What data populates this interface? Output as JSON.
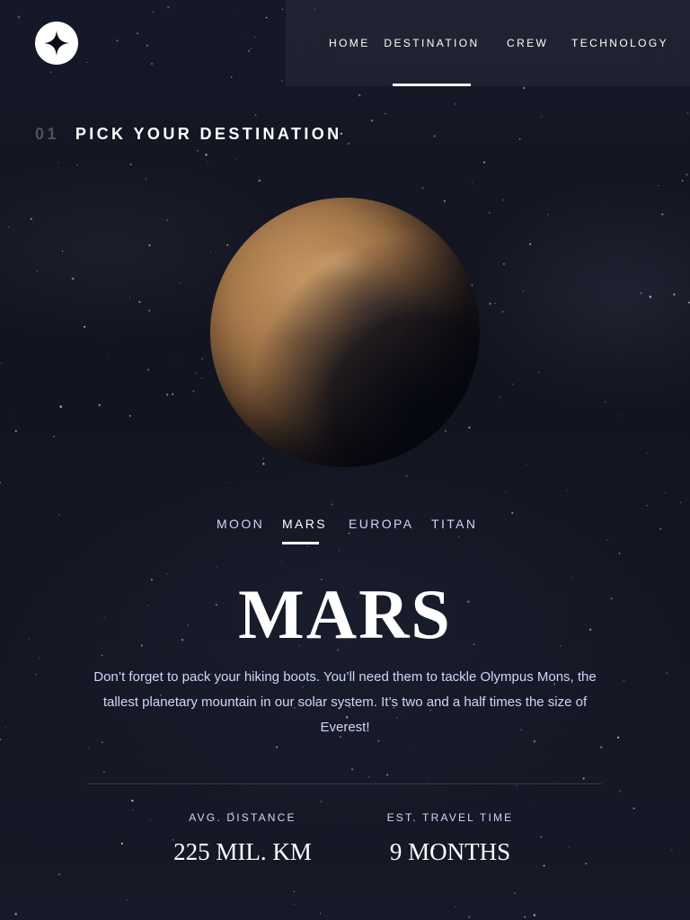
{
  "header": {
    "logo_icon": "star-logo-icon",
    "nav": [
      {
        "key": "home",
        "label": "HOME",
        "active": false
      },
      {
        "key": "destination",
        "label": "DESTINATION",
        "active": true
      },
      {
        "key": "crew",
        "label": "CREW",
        "active": false
      },
      {
        "key": "technology",
        "label": "TECHNOLOGY",
        "active": false
      }
    ]
  },
  "section": {
    "number": "01",
    "title": "PICK YOUR DESTINATION"
  },
  "tabs": [
    {
      "label": "MOON",
      "active": false
    },
    {
      "label": "MARS",
      "active": true
    },
    {
      "label": "EUROPA",
      "active": false
    },
    {
      "label": "TITAN",
      "active": false
    }
  ],
  "destination": {
    "image": "mars-planet-image",
    "name": "MARS",
    "description": "Don’t forget to pack your hiking boots. You’ll need them to tackle Olympus Mons, the tallest planetary mountain in our solar system. It’s two and a half times the size of Everest!",
    "stats": {
      "distance_label": "AVG. DISTANCE",
      "distance_value": "225 MIL. KM",
      "travel_label": "EST. TRAVEL TIME",
      "travel_value": "9 MONTHS"
    }
  },
  "colors": {
    "background": "#0b0d17",
    "text_primary": "#ffffff",
    "text_secondary": "#d0d6f9",
    "divider": "#383b4b"
  }
}
